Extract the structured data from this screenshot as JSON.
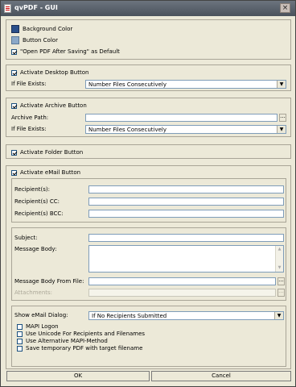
{
  "window": {
    "title": "qvPDF - GUI",
    "close_label": "×"
  },
  "general": {
    "background_color_label": "Background Color",
    "button_color_label": "Button Color",
    "open_pdf_label": "\"Open PDF After Saving\" as Default",
    "open_pdf_checked": true,
    "background_color": "#2a4f8a",
    "button_color": "#8aa8c8"
  },
  "desktop": {
    "activate_label": "Activate Desktop Button",
    "activate_checked": true,
    "if_exists_label": "If File Exists:",
    "if_exists_value": "Number Files Consecutively"
  },
  "archive": {
    "activate_label": "Activate Archive Button",
    "activate_checked": true,
    "path_label": "Archive Path:",
    "path_value": "",
    "browse_label": "...",
    "if_exists_label": "If File Exists:",
    "if_exists_value": "Number Files Consecutively"
  },
  "folder": {
    "activate_label": "Activate Folder Button",
    "activate_checked": true
  },
  "email": {
    "activate_label": "Activate eMail Button",
    "activate_checked": true,
    "recipients_label": "Recipient(s):",
    "cc_label": "Recipient(s) CC:",
    "bcc_label": "Recipient(s) BCC:",
    "subject_label": "Subject:",
    "body_label": "Message Body:",
    "body_file_label": "Message Body From File:",
    "attachments_label": "Attachments:",
    "browse_label": "...",
    "dialog_label": "Show eMail Dialog:",
    "dialog_value": "If No Recipients Submitted",
    "options": [
      {
        "label": "MAPI Logon",
        "checked": false
      },
      {
        "label": "Use Unicode For Recipients and Filenames",
        "checked": false
      },
      {
        "label": "Use Alternative MAPI-Method",
        "checked": false
      },
      {
        "label": "Save temporary PDF with target filename",
        "checked": false
      }
    ]
  },
  "footer": {
    "ok_label": "OK",
    "cancel_label": "Cancel"
  }
}
